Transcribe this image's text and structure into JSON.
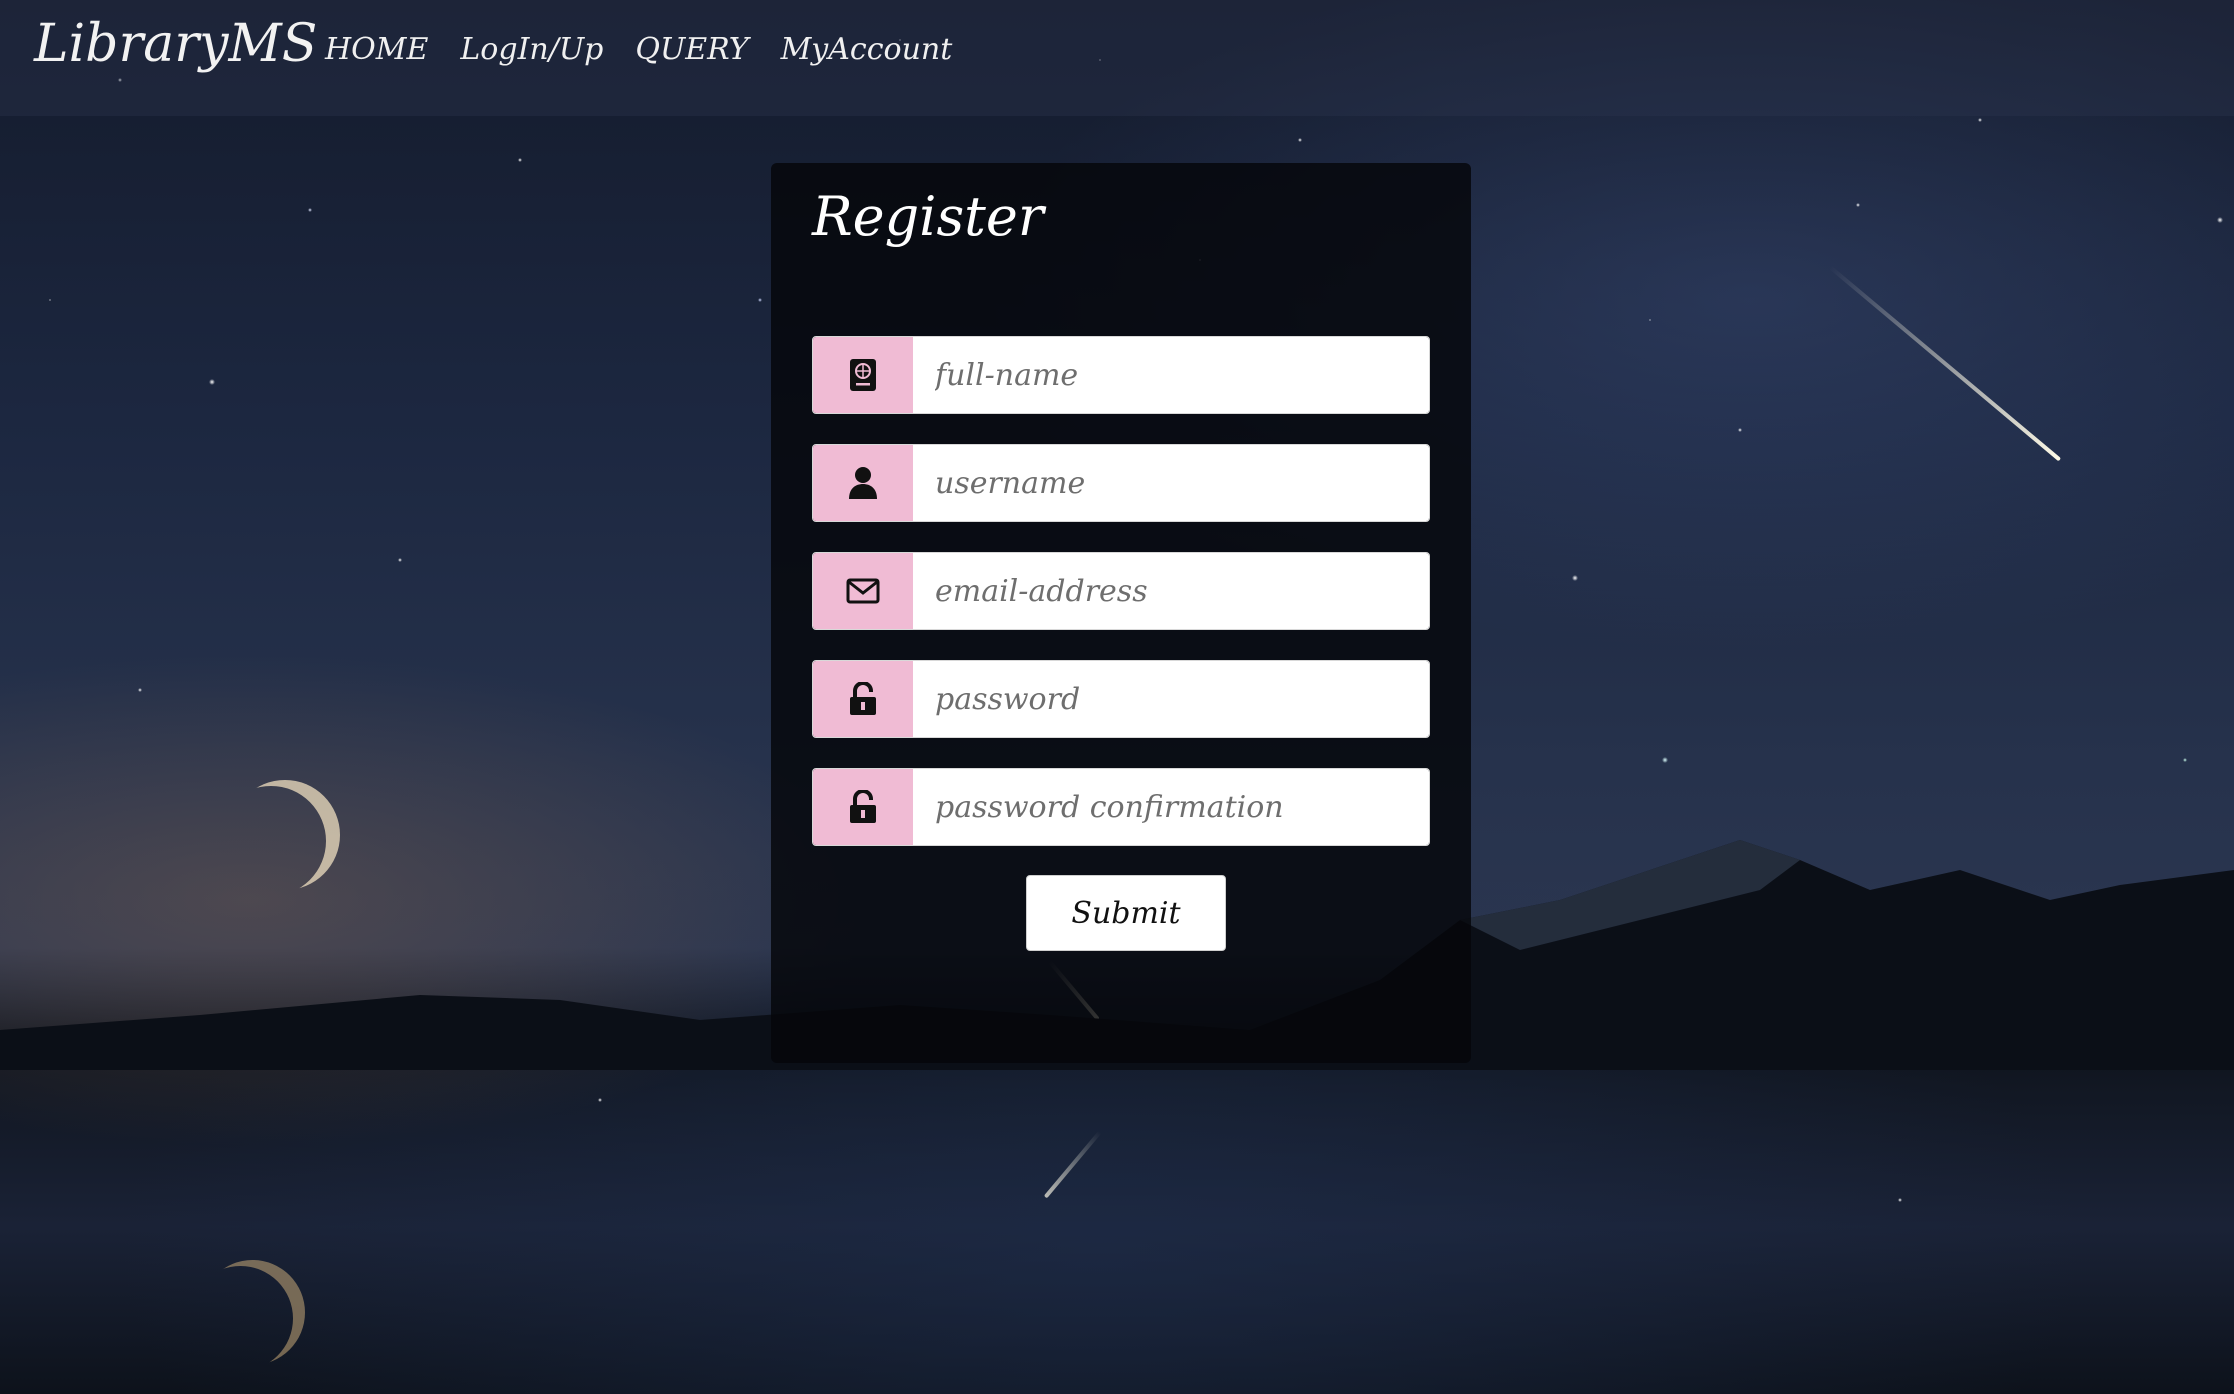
{
  "navbar": {
    "brand": "LibraryMS",
    "links": [
      {
        "label": "HOME"
      },
      {
        "label": "LogIn/Up"
      },
      {
        "label": "QUERY"
      },
      {
        "label": "MyAccount"
      }
    ]
  },
  "register": {
    "title": "Register",
    "fields": [
      {
        "placeholder": "full-name",
        "icon": "passport-icon",
        "value": ""
      },
      {
        "placeholder": "username",
        "icon": "user-icon",
        "value": ""
      },
      {
        "placeholder": "email-address",
        "icon": "envelope-icon",
        "value": ""
      },
      {
        "placeholder": "password",
        "icon": "unlock-icon",
        "value": ""
      },
      {
        "placeholder": "password confirmation",
        "icon": "unlock-icon",
        "value": ""
      }
    ],
    "submit_label": "Submit"
  },
  "colors": {
    "addon_bg": "#f0bbd4",
    "card_bg": "#05060a",
    "text_light": "#ffffff"
  }
}
